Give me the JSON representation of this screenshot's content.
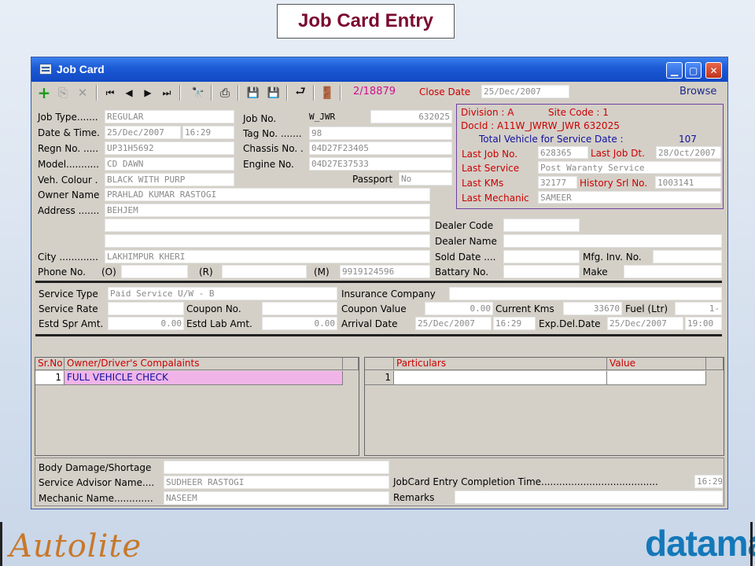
{
  "slide_title": "Job Card Entry",
  "window": {
    "title": "Job Card",
    "counter": "2/18879",
    "close_date_label": "Close Date",
    "close_date_value": "25/Dec/2007",
    "browse_label": "Browse"
  },
  "toolbar": {
    "add": "+",
    "copy": "⎘",
    "delete": "✕",
    "first": "⏮",
    "prev": "◀",
    "next": "▶",
    "last": "⏭",
    "find": "🔭",
    "print": "⎙",
    "save": "💾",
    "save_all": "💾",
    "undo": "⮐",
    "exit": "🚪"
  },
  "left": {
    "job_type_label": "Job Type.......",
    "job_type": "REGULAR",
    "date_time_label": "Date & Time.",
    "date": "25/Dec/2007",
    "time": "16:29",
    "regn_label": "Regn No. .....",
    "regn": "UP31H5692",
    "model_label": "Model...........",
    "model": "CD DAWN",
    "colour_label": "Veh. Colour .",
    "colour": "BLACK WITH PURP",
    "owner_label": "Owner Name",
    "owner": "PRAHLAD KUMAR RASTOGI",
    "address_label": "Address .......",
    "address1": "BEHJEM",
    "address2": "",
    "address3": "",
    "city_label": "City .............",
    "city": "LAKHIMPUR KHERI",
    "phone_label": "Phone No.",
    "phone_o_label": "(O)",
    "phone_o": "",
    "phone_r_label": "(R)",
    "phone_r": "",
    "phone_m_label": "(M)",
    "phone_m": "9919124596"
  },
  "middle": {
    "job_no_label": "Job No.",
    "job_no_prefix": "W_JWR",
    "job_no": "632025",
    "tag_label": "Tag No. .......",
    "tag": "98",
    "chassis_label": "Chassis No. .",
    "chassis": "04D27F23405",
    "engine_label": "Engine No.",
    "engine": "04D27E37533",
    "passport_label": "Passport",
    "passport": "No"
  },
  "division": {
    "division_label": "Division : A",
    "site_code_label": "Site Code : 1",
    "docid_label": "DocId : A11W_JWRW_JWR  632025",
    "total_label": "Total Vehicle for Service Date :",
    "total_value": "107",
    "last_job_label": "Last Job No.",
    "last_job": "628365",
    "last_job_dt_label": "Last Job Dt.",
    "last_job_dt": "28/Oct/2007",
    "last_service_label": "Last Service",
    "last_service": "Post Waranty Service",
    "last_kms_label": "Last KMs",
    "last_kms": "32177",
    "history_label": "History Srl No.",
    "history": "1003141",
    "last_mechanic_label": "Last Mechanic",
    "last_mechanic": "SAMEER"
  },
  "dealer": {
    "dealer_code_label": "Dealer Code",
    "dealer_code": "",
    "dealer_name_label": "Dealer Name",
    "dealer_name": "",
    "sold_date_label": "Sold Date ....",
    "sold_date": "",
    "mfg_inv_label": "Mfg. Inv. No.",
    "mfg_inv": "",
    "battery_label": "Battary No.",
    "battery": "",
    "make_label": "Make",
    "make": ""
  },
  "service": {
    "service_type_label": "Service Type",
    "service_type": "Paid Service U/W - B",
    "insurance_label": "Insurance Company",
    "insurance": "",
    "service_rate_label": "Service Rate",
    "service_rate": "",
    "coupon_no_label": "Coupon No.",
    "coupon_no": "",
    "coupon_value_label": "Coupon Value",
    "coupon_value": "0.00",
    "current_kms_label": "Current Kms",
    "current_kms": "33670",
    "fuel_label": "Fuel (Ltr)",
    "fuel": "1-",
    "estd_spr_label": "Estd Spr Amt.",
    "estd_spr": "0.00",
    "estd_lab_label": "Estd Lab Amt.",
    "estd_lab": "0.00",
    "arrival_label": "Arrival Date",
    "arrival_date": "25/Dec/2007",
    "arrival_time": "16:29",
    "exp_del_label": "Exp.Del.Date",
    "exp_del_date": "25/Dec/2007",
    "exp_del_time": "19:00"
  },
  "complaints_grid": {
    "headers": [
      "Sr.No",
      "Owner/Driver's Compalaints"
    ],
    "rows": [
      {
        "sr": "1",
        "text": "FULL VEHICLE CHECK"
      }
    ]
  },
  "particulars_grid": {
    "headers": [
      "",
      "Particulars",
      "Value"
    ],
    "rows": [
      {
        "sr": "1",
        "particular": "",
        "value": ""
      }
    ]
  },
  "bottom": {
    "body_damage_label": "Body Damage/Shortage",
    "body_damage": "",
    "advisor_label": "Service Advisor Name....",
    "advisor": "SUDHEER RASTOGI",
    "mechanic_label": "Mechanic Name.............",
    "mechanic": "NASEEM",
    "completion_label": "JobCard Entry Completion Time.......................................",
    "completion": "16:29",
    "remarks_label": "Remarks",
    "remarks": ""
  },
  "logos": {
    "left": "Autolite",
    "right": "dataman"
  },
  "colors": {
    "title_bar": "#1e5cd6",
    "label_red": "#cc0000",
    "counter_purple": "#d0108c",
    "grid_selected": "#f0b4e8",
    "grid_text_blue": "#1010a0"
  }
}
